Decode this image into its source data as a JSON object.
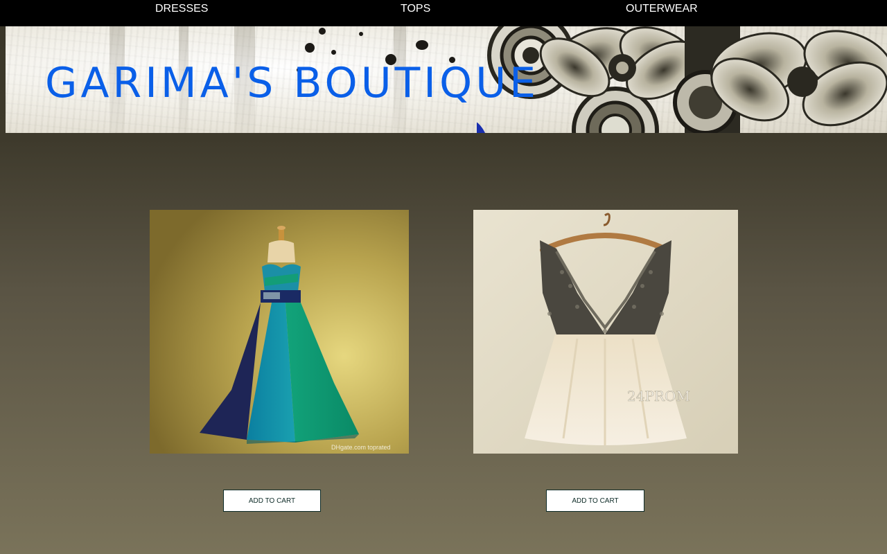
{
  "nav": {
    "dresses": "DRESSES",
    "tops": "TOPS",
    "outerwear": "OUTERWEAR"
  },
  "banner": {
    "title": "GARIMA'S BOUTIQUE"
  },
  "products": [
    {
      "image": "teal-green-navy-strapless-ball-gown",
      "watermark": "DHgate.com  toprated",
      "button_label": "ADD TO CART"
    },
    {
      "image": "beaded-lace-tulle-short-dress-on-hanger",
      "watermark": "24PROM",
      "button_label": "ADD TO CART"
    }
  ],
  "colors": {
    "nav_background": "#000000",
    "nav_text": "#ffffff",
    "title": "#0a5fe8",
    "button_border": "#0c2a26"
  }
}
